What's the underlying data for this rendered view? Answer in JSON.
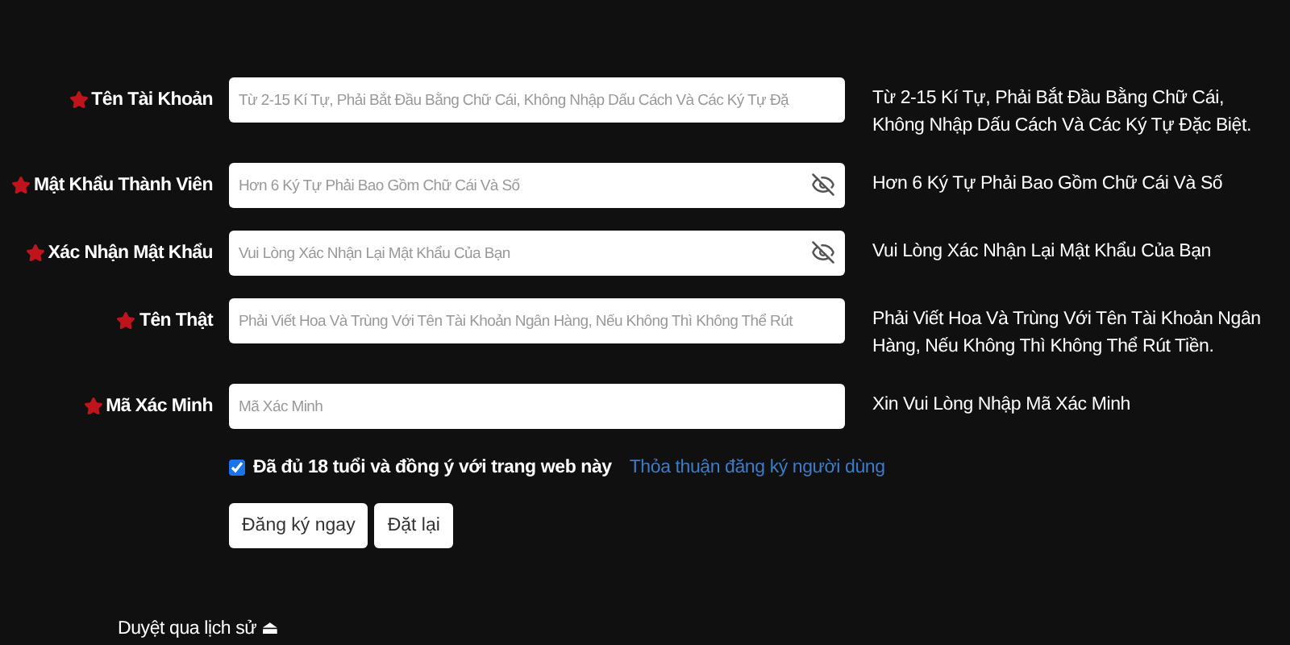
{
  "fields": [
    {
      "label": "Tên Tài Khoản",
      "required": true,
      "placeholder": "Từ 2-15 Kí Tự, Phải Bắt Đầu Bằng Chữ Cái, Không Nhập Dấu Cách Và Các Ký Tự Đặ",
      "kind": "text",
      "hint": "Từ 2-15 Kí Tự, Phải Bắt Đầu Bằng Chữ Cái, Không Nhập Dấu Cách Và Các Ký Tự Đặc Biệt."
    },
    {
      "label": "Mật Khẩu Thành Viên",
      "required": true,
      "placeholder": "Hơn 6 Ký Tự Phải Bao Gồm Chữ Cái Và Số",
      "kind": "password",
      "hint": "Hơn 6 Ký Tự Phải Bao Gồm Chữ Cái Và Số"
    },
    {
      "label": "Xác Nhận Mật Khẩu",
      "required": true,
      "placeholder": "Vui Lòng Xác Nhận Lại Mật Khẩu Của Bạn",
      "kind": "password",
      "hint": "Vui Lòng Xác Nhận Lại Mật Khẩu Của Bạn"
    },
    {
      "label": "Tên Thật",
      "required": true,
      "placeholder": "Phải Viết Hoa Và Trùng Với Tên Tài Khoản Ngân Hàng, Nếu Không Thì Không Thể Rút",
      "kind": "text",
      "hint": "Phải Viết Hoa Và Trùng Với Tên Tài Khoản Ngân Hàng, Nếu Không Thì Không Thể Rút Tiền."
    },
    {
      "label": "Mã Xác Minh",
      "required": true,
      "placeholder": "Mã Xác Minh",
      "kind": "text",
      "hint": "Xin Vui Lòng Nhập Mã Xác Minh"
    }
  ],
  "agreement": {
    "checked": true,
    "label": "Đã đủ 18 tuổi và đồng ý với trang web này",
    "link": "Thỏa thuận đăng ký người dùng"
  },
  "buttons": [
    "Đăng ký ngay",
    "Đặt lại"
  ],
  "history_toggle": "Duyệt qua lịch sử ⏏"
}
